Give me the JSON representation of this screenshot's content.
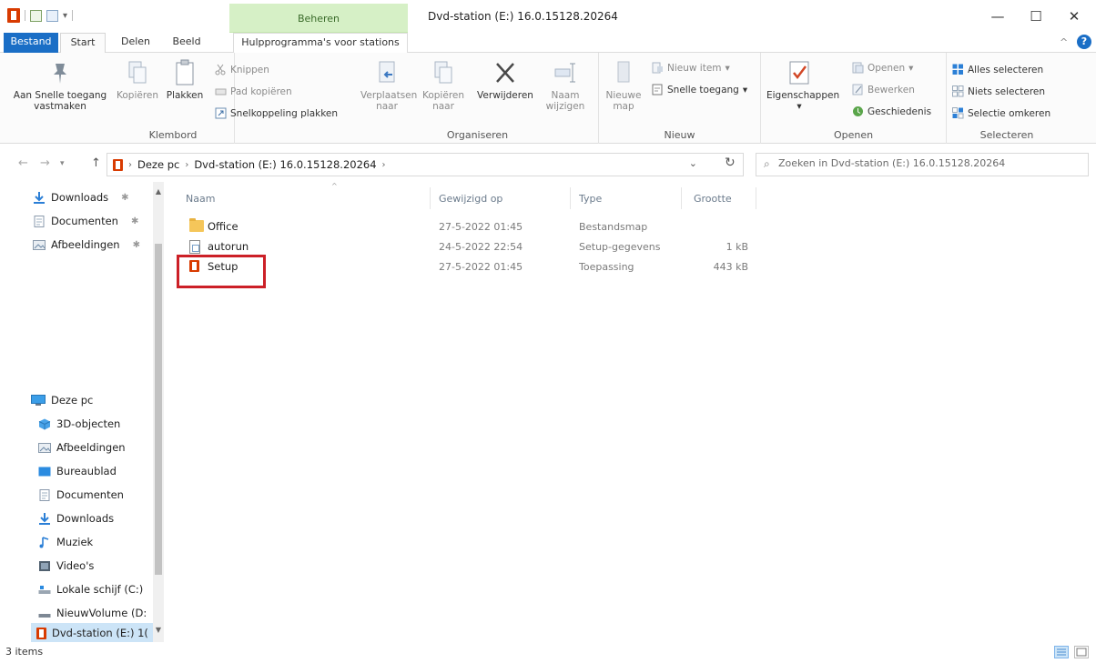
{
  "window": {
    "title": "Dvd-station (E:) 16.0.15128.20264",
    "context_tab": "Beheren",
    "minimize": "—",
    "maximize": "☐",
    "close": "✕",
    "qat_arrow": "▾"
  },
  "tabs": {
    "file": "Bestand",
    "start": "Start",
    "share": "Delen",
    "view": "Beeld",
    "tools": "Hulpprogramma's voor stations",
    "collapse": "^",
    "help": "?"
  },
  "ribbon": {
    "clipboard": {
      "label": "Klembord",
      "pin": "Aan Snelle toegang vastmaken",
      "copy": "Kopiëren",
      "paste": "Plakken",
      "cut": "Knippen",
      "copy_path": "Pad kopiëren",
      "paste_shortcut": "Snelkoppeling plakken"
    },
    "organize": {
      "label": "Organiseren",
      "move_to": "Verplaatsen naar",
      "copy_to": "Kopiëren naar",
      "delete": "Verwijderen",
      "rename": "Naam wijzigen"
    },
    "new": {
      "label": "Nieuw",
      "new_folder": "Nieuwe map",
      "new_item": "Nieuw item",
      "easy_access": "Snelle toegang"
    },
    "open": {
      "label": "Openen",
      "properties": "Eigenschappen",
      "open": "Openen",
      "edit": "Bewerken",
      "history": "Geschiedenis"
    },
    "select": {
      "label": "Selecteren",
      "select_all": "Alles selecteren",
      "select_none": "Niets selecteren",
      "invert": "Selectie omkeren"
    }
  },
  "address": {
    "back": "←",
    "forward": "→",
    "up": "↑",
    "crumbs": [
      "Deze pc",
      "Dvd-station (E:) 16.0.15128.20264"
    ],
    "separator": "›",
    "dropdown": "⌄",
    "refresh": "↻",
    "search_placeholder": "Zoeken in Dvd-station (E:) 16.0.15128.20264",
    "search_icon": "⌕"
  },
  "nav": {
    "pin": "✱",
    "quick": [
      {
        "label": "Downloads",
        "icon": "download-arrow-icon"
      },
      {
        "label": "Documenten",
        "icon": "document-icon"
      },
      {
        "label": "Afbeeldingen",
        "icon": "pictures-icon"
      }
    ],
    "this_pc": "Deze pc",
    "pc_items": [
      {
        "label": "3D-objecten",
        "icon": "3d-objects-icon"
      },
      {
        "label": "Afbeeldingen",
        "icon": "pictures-icon"
      },
      {
        "label": "Bureaublad",
        "icon": "desktop-icon"
      },
      {
        "label": "Documenten",
        "icon": "document-icon"
      },
      {
        "label": "Downloads",
        "icon": "download-arrow-icon"
      },
      {
        "label": "Muziek",
        "icon": "music-note-icon"
      },
      {
        "label": "Video's",
        "icon": "video-icon"
      },
      {
        "label": "Lokale schijf (C:)",
        "icon": "drive-icon"
      },
      {
        "label": "NieuwVolume (D:",
        "icon": "drive-icon"
      },
      {
        "label": "Dvd-station (E:) 1(",
        "icon": "office-logo-icon"
      }
    ],
    "scroll_up": "▲",
    "scroll_down": "▼"
  },
  "list": {
    "columns": {
      "name": "Naam",
      "modified": "Gewijzigd op",
      "type": "Type",
      "size": "Grootte"
    },
    "sort_indicator": "^",
    "rows": [
      {
        "name": "Office",
        "modified": "27-5-2022 01:45",
        "type": "Bestandsmap",
        "size": ""
      },
      {
        "name": "autorun",
        "modified": "24-5-2022 22:54",
        "type": "Setup-gegevens",
        "size": "1 kB"
      },
      {
        "name": "Setup",
        "modified": "27-5-2022 01:45",
        "type": "Toepassing",
        "size": "443 kB"
      }
    ]
  },
  "status": {
    "items": "3 items"
  },
  "colors": {
    "accent": "#1a6ec6",
    "manage_tab": "#d6f0c6",
    "highlight_box": "#cc2027",
    "office_orange": "#d83b01"
  }
}
